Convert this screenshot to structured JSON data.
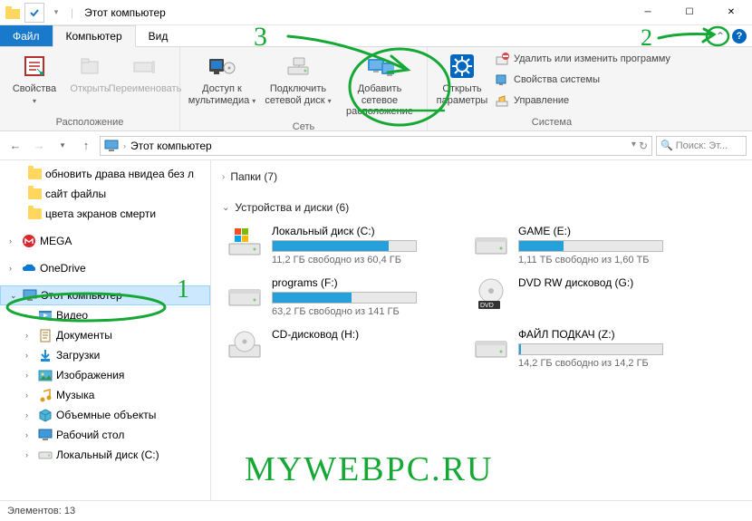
{
  "title": "Этот компьютер",
  "tabs": {
    "file": "Файл",
    "computer": "Компьютер",
    "view": "Вид"
  },
  "ribbon": {
    "location": {
      "label": "Расположение",
      "properties": "Свойства",
      "open": "Открыть",
      "rename": "Переименовать"
    },
    "network": {
      "label": "Сеть",
      "media": "Доступ к мультимедиа",
      "map_drive": "Подключить сетевой диск",
      "add_location": "Добавить сетевое расположение"
    },
    "system": {
      "label": "Система",
      "open_settings": "Открыть параметры",
      "uninstall": "Удалить или изменить программу",
      "sys_props": "Свойства системы",
      "manage": "Управление"
    }
  },
  "breadcrumb": "Этот компьютер",
  "search_placeholder": "Поиск: Эт...",
  "tree": {
    "folders": [
      "обновить драва нвидеа без л",
      "сайт файлы",
      "цвета экранов смерти"
    ],
    "mega": "MEGA",
    "onedrive": "OneDrive",
    "this_pc": "Этот компьютер",
    "children": [
      "Видео",
      "Документы",
      "Загрузки",
      "Изображения",
      "Музыка",
      "Объемные объекты",
      "Рабочий стол",
      "Локальный диск (C:)"
    ]
  },
  "content": {
    "folders_label": "Папки (7)",
    "devices_label": "Устройства и диски (6)",
    "drives": [
      {
        "name": "Локальный диск (C:)",
        "free": "11,2 ГБ свободно из 60,4 ГБ",
        "fill": 81,
        "type": "hdd_win"
      },
      {
        "name": "GAME (E:)",
        "free": "1,11 ТБ свободно из 1,60 ТБ",
        "fill": 31,
        "type": "hdd"
      },
      {
        "name": "programs (F:)",
        "free": "63,2 ГБ свободно из 141 ГБ",
        "fill": 55,
        "type": "hdd"
      },
      {
        "name": "DVD RW дисковод (G:)",
        "free": "",
        "fill": null,
        "type": "dvd"
      },
      {
        "name": "CD-дисковод (H:)",
        "free": "",
        "fill": null,
        "type": "cd"
      },
      {
        "name": "ФАЙЛ ПОДКАЧ (Z:)",
        "free": "14,2 ГБ свободно из 14,2 ГБ",
        "fill": 1,
        "type": "hdd"
      }
    ]
  },
  "status": "Элементов: 13",
  "watermark": "MYWEBPC.RU",
  "anno": {
    "one": "1",
    "two": "2",
    "three": "3"
  }
}
